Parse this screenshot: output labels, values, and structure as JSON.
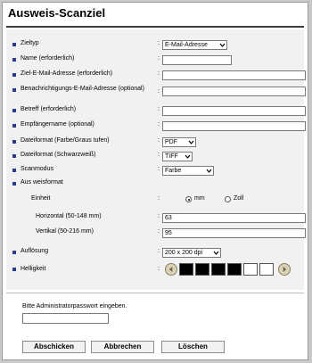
{
  "page": {
    "title": "Ausweis-Scanziel"
  },
  "colors": {
    "bullet": "#2b3a91",
    "black_swatch": "#000000",
    "white_swatch": "#ffffff"
  },
  "fields": {
    "zieltyp": {
      "label": "Zieltyp",
      "value": "E-Mail-Adresse"
    },
    "name": {
      "label": "Name (erforderlich)",
      "value": ""
    },
    "ziel_email": {
      "label": "Ziel-E-Mail-Adresse (erforderlich)",
      "value": ""
    },
    "benachrichtigung": {
      "label": "Benachrichtigungs-E-Mail-Adresse (optional)",
      "value": ""
    },
    "betreff": {
      "label": "Betreff (erforderlich)",
      "value": ""
    },
    "empfaenger": {
      "label": "Empfängername (optional)",
      "value": ""
    },
    "dateiformat_farbe": {
      "label": "Dateiformat (Farbe/Graus tufen)",
      "value": "PDF"
    },
    "dateiformat_sw": {
      "label": "Dateiformat (Schwarzweiß)",
      "value": "TIFF"
    },
    "scanmodus": {
      "label": "Scanmodus",
      "value": "Farbe"
    },
    "ausweisformat": {
      "label": "Aus weisformat"
    },
    "einheit": {
      "label": "Einheit",
      "option_mm": "mm",
      "option_zoll": "Zoll",
      "selected": "mm"
    },
    "horizontal": {
      "label": "Horizontal (50-148 mm)",
      "value": "63"
    },
    "vertikal": {
      "label": "Vertikal (50-216 mm)",
      "value": "95"
    },
    "aufloesung": {
      "label": "Auflösung",
      "value": "200 x 200 dpi"
    },
    "helligkeit": {
      "label": "Helligkeit",
      "level": 3,
      "levels": 7
    }
  },
  "colon": ":",
  "password": {
    "label": "Bitte Administratorpasswort eingeben.",
    "value": ""
  },
  "buttons": {
    "submit": "Abschicken",
    "cancel": "Abbrechen",
    "delete": "Löschen"
  }
}
